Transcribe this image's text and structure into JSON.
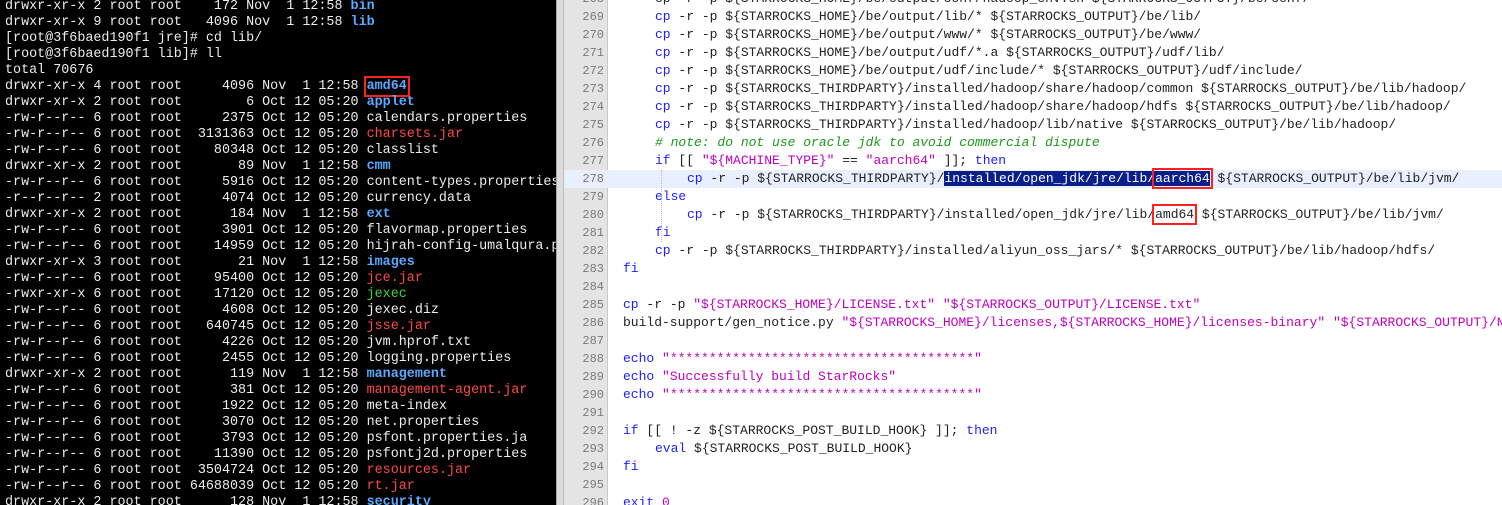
{
  "terminal": {
    "lines": [
      {
        "meta": "drwxr-xr-x 2 root root    172 Nov  1 12:58 ",
        "name": "bin",
        "kind": "dir"
      },
      {
        "meta": "drwxr-xr-x 9 root root   4096 Nov  1 12:58 ",
        "name": "lib",
        "kind": "dir"
      },
      {
        "meta": "[root@3f6baed190f1 jre]# cd lib/",
        "name": "",
        "kind": "plain"
      },
      {
        "meta": "[root@3f6baed190f1 lib]# ll",
        "name": "",
        "kind": "plain"
      },
      {
        "meta": "total 70676",
        "name": "",
        "kind": "plain"
      },
      {
        "meta": "drwxr-xr-x 4 root root     4096 Nov  1 12:58 ",
        "name": "amd64",
        "kind": "dir",
        "boxed": true
      },
      {
        "meta": "drwxr-xr-x 2 root root        6 Oct 12 05:20 ",
        "name": "applet",
        "kind": "dir"
      },
      {
        "meta": "-rw-r--r-- 6 root root     2375 Oct 12 05:20 ",
        "name": "calendars.properties",
        "kind": "plain"
      },
      {
        "meta": "-rw-r--r-- 6 root root  3131363 Oct 12 05:20 ",
        "name": "charsets.jar",
        "kind": "jar"
      },
      {
        "meta": "-rw-r--r-- 6 root root    80348 Oct 12 05:20 ",
        "name": "classlist",
        "kind": "plain"
      },
      {
        "meta": "drwxr-xr-x 2 root root       89 Nov  1 12:58 ",
        "name": "cmm",
        "kind": "dir"
      },
      {
        "meta": "-rw-r--r-- 6 root root     5916 Oct 12 05:20 ",
        "name": "content-types.properties",
        "kind": "plain"
      },
      {
        "meta": "-r--r--r-- 2 root root     4074 Oct 12 05:20 ",
        "name": "currency.data",
        "kind": "plain"
      },
      {
        "meta": "drwxr-xr-x 2 root root      184 Nov  1 12:58 ",
        "name": "ext",
        "kind": "dir"
      },
      {
        "meta": "-rw-r--r-- 6 root root     3901 Oct 12 05:20 ",
        "name": "flavormap.properties",
        "kind": "plain"
      },
      {
        "meta": "-rw-r--r-- 6 root root    14959 Oct 12 05:20 ",
        "name": "hijrah-config-umalqura.properties",
        "kind": "plain"
      },
      {
        "meta": "drwxr-xr-x 3 root root       21 Nov  1 12:58 ",
        "name": "images",
        "kind": "dir"
      },
      {
        "meta": "-rw-r--r-- 6 root root    95400 Oct 12 05:20 ",
        "name": "jce.jar",
        "kind": "jar"
      },
      {
        "meta": "-rwxr-xr-x 6 root root    17120 Oct 12 05:20 ",
        "name": "jexec",
        "kind": "exec"
      },
      {
        "meta": "-rw-r--r-- 6 root root     4608 Oct 12 05:20 ",
        "name": "jexec.diz",
        "kind": "plain"
      },
      {
        "meta": "-rw-r--r-- 6 root root   640745 Oct 12 05:20 ",
        "name": "jsse.jar",
        "kind": "jar"
      },
      {
        "meta": "-rw-r--r-- 6 root root     4226 Oct 12 05:20 ",
        "name": "jvm.hprof.txt",
        "kind": "plain"
      },
      {
        "meta": "-rw-r--r-- 6 root root     2455 Oct 12 05:20 ",
        "name": "logging.properties",
        "kind": "plain"
      },
      {
        "meta": "drwxr-xr-x 2 root root      119 Nov  1 12:58 ",
        "name": "management",
        "kind": "dir"
      },
      {
        "meta": "-rw-r--r-- 6 root root      381 Oct 12 05:20 ",
        "name": "management-agent.jar",
        "kind": "jar"
      },
      {
        "meta": "-rw-r--r-- 6 root root     1922 Oct 12 05:20 ",
        "name": "meta-index",
        "kind": "plain"
      },
      {
        "meta": "-rw-r--r-- 6 root root     3070 Oct 12 05:20 ",
        "name": "net.properties",
        "kind": "plain"
      },
      {
        "meta": "-rw-r--r-- 6 root root     3793 Oct 12 05:20 ",
        "name": "psfont.properties.ja",
        "kind": "plain"
      },
      {
        "meta": "-rw-r--r-- 6 root root    11390 Oct 12 05:20 ",
        "name": "psfontj2d.properties",
        "kind": "plain"
      },
      {
        "meta": "-rw-r--r-- 6 root root  3504724 Oct 12 05:20 ",
        "name": "resources.jar",
        "kind": "jar"
      },
      {
        "meta": "-rw-r--r-- 6 root root 64688039 Oct 12 05:20 ",
        "name": "rt.jar",
        "kind": "jar"
      },
      {
        "meta": "drwxr-xr-x 2 root root      128 Nov  1 12:58 ",
        "name": "security",
        "kind": "dir"
      }
    ]
  },
  "editor": {
    "current_line": 278,
    "lines": [
      {
        "num": "268",
        "indent": 1,
        "tokens": [
          {
            "t": "cp -r -p ${STARROCKS_HOME}/be/output/conf/hadoop_env.sh ${STARROCKS_OUTPUT}/be/conf/",
            "c": "pl"
          }
        ]
      },
      {
        "num": "269",
        "indent": 1,
        "tokens": [
          {
            "t": "cp",
            "c": "kw"
          },
          {
            "t": " -r -p ${STARROCKS_HOME}/be/output/lib/* ${STARROCKS_OUTPUT}/be/lib/",
            "c": "pl"
          }
        ]
      },
      {
        "num": "270",
        "indent": 1,
        "tokens": [
          {
            "t": "cp",
            "c": "kw"
          },
          {
            "t": " -r -p ${STARROCKS_HOME}/be/output/www/* ${STARROCKS_OUTPUT}/be/www/",
            "c": "pl"
          }
        ]
      },
      {
        "num": "271",
        "indent": 1,
        "tokens": [
          {
            "t": "cp",
            "c": "kw"
          },
          {
            "t": " -r -p ${STARROCKS_HOME}/be/output/udf/*.a ${STARROCKS_OUTPUT}/udf/lib/",
            "c": "pl"
          }
        ]
      },
      {
        "num": "272",
        "indent": 1,
        "tokens": [
          {
            "t": "cp",
            "c": "kw"
          },
          {
            "t": " -r -p ${STARROCKS_HOME}/be/output/udf/include/* ${STARROCKS_OUTPUT}/udf/include/",
            "c": "pl"
          }
        ]
      },
      {
        "num": "273",
        "indent": 1,
        "tokens": [
          {
            "t": "cp",
            "c": "kw"
          },
          {
            "t": " -r -p ${STARROCKS_THIRDPARTY}/installed/hadoop/share/hadoop/common ${STARROCKS_OUTPUT}/be/lib/hadoop/",
            "c": "pl"
          }
        ]
      },
      {
        "num": "274",
        "indent": 1,
        "tokens": [
          {
            "t": "cp",
            "c": "kw"
          },
          {
            "t": " -r -p ${STARROCKS_THIRDPARTY}/installed/hadoop/share/hadoop/hdfs ${STARROCKS_OUTPUT}/be/lib/hadoop/",
            "c": "pl"
          }
        ]
      },
      {
        "num": "275",
        "indent": 1,
        "tokens": [
          {
            "t": "cp",
            "c": "kw"
          },
          {
            "t": " -r -p ${STARROCKS_THIRDPARTY}/installed/hadoop/lib/native ${STARROCKS_OUTPUT}/be/lib/hadoop/",
            "c": "pl"
          }
        ]
      },
      {
        "num": "276",
        "indent": 1,
        "tokens": [
          {
            "t": "# note: do not use oracle jdk to avoid commercial dispute",
            "c": "com"
          }
        ]
      },
      {
        "num": "277",
        "indent": 1,
        "tokens": [
          {
            "t": "if",
            "c": "kw"
          },
          {
            "t": " [[ ",
            "c": "pl"
          },
          {
            "t": "\"${MACHINE_TYPE}\"",
            "c": "str"
          },
          {
            "t": " == ",
            "c": "pl"
          },
          {
            "t": "\"aarch64\"",
            "c": "str"
          },
          {
            "t": " ]]; ",
            "c": "pl"
          },
          {
            "t": "then",
            "c": "kw"
          }
        ]
      },
      {
        "num": "278",
        "indent": 2,
        "tokens": [
          {
            "t": "cp",
            "c": "kw"
          },
          {
            "t": " -r -p ${STARROCKS_THIRDPARTY}/",
            "c": "pl"
          },
          {
            "t": "installed/open_jdk/jre/lib/",
            "c": "sel"
          },
          {
            "t": "aarch64",
            "c": "selbox"
          },
          {
            "t": " ${STARROCKS_OUTPUT}/be/lib/jvm/",
            "c": "pl"
          }
        ]
      },
      {
        "num": "279",
        "indent": 1,
        "tokens": [
          {
            "t": "else",
            "c": "kw"
          }
        ]
      },
      {
        "num": "280",
        "indent": 2,
        "tokens": [
          {
            "t": "cp",
            "c": "kw"
          },
          {
            "t": " -r -p ${STARROCKS_THIRDPARTY}/installed/open_jdk/jre/lib/",
            "c": "pl"
          },
          {
            "t": "amd64",
            "c": "box"
          },
          {
            "t": " ${STARROCKS_OUTPUT}/be/lib/jvm/",
            "c": "pl"
          }
        ]
      },
      {
        "num": "281",
        "indent": 1,
        "tokens": [
          {
            "t": "fi",
            "c": "kw"
          }
        ]
      },
      {
        "num": "282",
        "indent": 1,
        "tokens": [
          {
            "t": "cp",
            "c": "kw"
          },
          {
            "t": " -r -p ${STARROCKS_THIRDPARTY}/installed/aliyun_oss_jars/* ${STARROCKS_OUTPUT}/be/lib/hadoop/hdfs/",
            "c": "pl"
          }
        ]
      },
      {
        "num": "283",
        "indent": 0,
        "tokens": [
          {
            "t": "fi",
            "c": "kw"
          }
        ]
      },
      {
        "num": "284",
        "indent": 0,
        "tokens": []
      },
      {
        "num": "285",
        "indent": 0,
        "tokens": [
          {
            "t": "cp",
            "c": "kw"
          },
          {
            "t": " -r -p ",
            "c": "pl"
          },
          {
            "t": "\"${STARROCKS_HOME}/LICENSE.txt\"",
            "c": "str"
          },
          {
            "t": " ",
            "c": "pl"
          },
          {
            "t": "\"${STARROCKS_OUTPUT}/LICENSE.txt\"",
            "c": "str"
          }
        ]
      },
      {
        "num": "286",
        "indent": 0,
        "tokens": [
          {
            "t": "build-support/gen_notice.py ",
            "c": "pl"
          },
          {
            "t": "\"${STARROCKS_HOME}/licenses,${STARROCKS_HOME}/licenses-binary\"",
            "c": "str"
          },
          {
            "t": " ",
            "c": "pl"
          },
          {
            "t": "\"${STARROCKS_OUTPUT}/NOTICE.txt\"",
            "c": "str"
          }
        ]
      },
      {
        "num": "287",
        "indent": 0,
        "tokens": []
      },
      {
        "num": "288",
        "indent": 0,
        "tokens": [
          {
            "t": "echo",
            "c": "kw"
          },
          {
            "t": " ",
            "c": "pl"
          },
          {
            "t": "\"***************************************\"",
            "c": "str"
          }
        ]
      },
      {
        "num": "289",
        "indent": 0,
        "tokens": [
          {
            "t": "echo",
            "c": "kw"
          },
          {
            "t": " ",
            "c": "pl"
          },
          {
            "t": "\"Successfully build StarRocks\"",
            "c": "str"
          }
        ]
      },
      {
        "num": "290",
        "indent": 0,
        "tokens": [
          {
            "t": "echo",
            "c": "kw"
          },
          {
            "t": " ",
            "c": "pl"
          },
          {
            "t": "\"***************************************\"",
            "c": "str"
          }
        ]
      },
      {
        "num": "291",
        "indent": 0,
        "tokens": []
      },
      {
        "num": "292",
        "indent": 0,
        "tokens": [
          {
            "t": "if",
            "c": "kw"
          },
          {
            "t": " [[ ! -z ${STARROCKS_POST_BUILD_HOOK} ]]; ",
            "c": "pl"
          },
          {
            "t": "then",
            "c": "kw"
          }
        ]
      },
      {
        "num": "293",
        "indent": 1,
        "tokens": [
          {
            "t": "eval",
            "c": "kw"
          },
          {
            "t": " ${STARROCKS_POST_BUILD_HOOK}",
            "c": "pl"
          }
        ]
      },
      {
        "num": "294",
        "indent": 0,
        "tokens": [
          {
            "t": "fi",
            "c": "kw"
          }
        ]
      },
      {
        "num": "295",
        "indent": 0,
        "tokens": []
      },
      {
        "num": "296",
        "indent": 0,
        "tokens": [
          {
            "t": "exit",
            "c": "kw"
          },
          {
            "t": " ",
            "c": "pl"
          },
          {
            "t": "0",
            "c": "str"
          }
        ]
      }
    ]
  }
}
